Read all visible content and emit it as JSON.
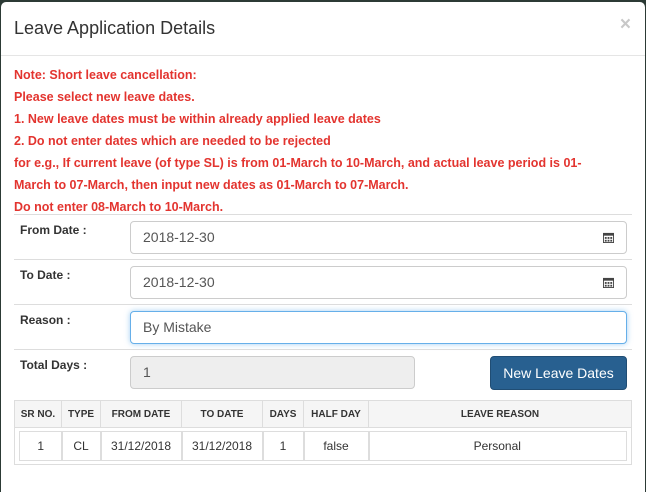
{
  "modal": {
    "title": "Leave Application Details",
    "close_label": "×"
  },
  "notes": [
    "Note: Short leave cancellation:",
    "Please select new leave dates.",
    "1. New leave dates must be within already applied leave dates",
    "2. Do not enter dates which are needed to be rejected",
    "for e.g., If current leave (of type SL) is from 01-March to 10-March, and actual leave period is 01-",
    "March to 07-March, then input new dates as 01-March to 07-March.",
    "Do not enter 08-March to 10-March."
  ],
  "form": {
    "from_date": {
      "label": "From Date :",
      "value": "2018-12-30"
    },
    "to_date": {
      "label": "To Date :",
      "value": "2018-12-30"
    },
    "reason": {
      "label": "Reason :",
      "value": "By Mistake"
    },
    "total_days": {
      "label": "Total Days :",
      "value": "1"
    },
    "submit_label": "New Leave Dates"
  },
  "table": {
    "headers": [
      "SR NO.",
      "TYPE",
      "FROM DATE",
      "TO DATE",
      "DAYS",
      "HALF DAY",
      "LEAVE REASON"
    ],
    "rows": [
      [
        "1",
        "CL",
        "31/12/2018",
        "31/12/2018",
        "1",
        "false",
        "Personal"
      ]
    ]
  },
  "colors": {
    "note": "#e3342f",
    "primary": "#286090",
    "backdrop": "#2c3a35"
  }
}
